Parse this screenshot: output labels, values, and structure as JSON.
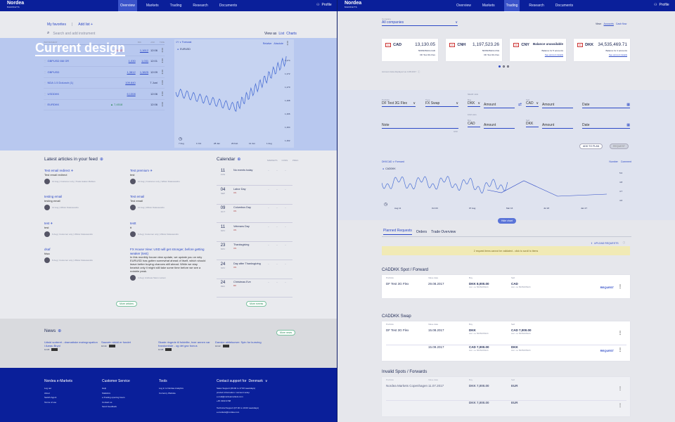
{
  "overlay_label": "Current design",
  "left": {
    "brand": {
      "name": "Nordea",
      "sub": "MARKETS"
    },
    "nav": [
      "Overview",
      "Markets",
      "Trading",
      "Research",
      "Documents"
    ],
    "profile": "Profile",
    "watchlist": {
      "tab1": "My favorites",
      "tab2": "Add list +",
      "search_placeholder": "Search and add instrument",
      "view_as": "View as",
      "view_list": "List",
      "view_charts": "Charts",
      "cols": [
        "INSTRUMENT",
        "",
        "BID",
        "ASK",
        "TIME"
      ],
      "rows": [
        {
          "name": "",
          "sub": "",
          "bid": "",
          "ask": "1,1612",
          "time": "12:06",
          "chg": "▼ 1,1612"
        },
        {
          "name": "GBPUSD 6M OR",
          "sub": "",
          "bid": "1,030",
          "ask": "1,031",
          "time": "12:01",
          "chg": ""
        },
        {
          "name": "GBPUSD",
          "sub": "",
          "bid": "1,3812",
          "ask": "1,3825",
          "time": "12:09",
          "chg": ""
        },
        {
          "name": "NDA 1.5 Dolunch (1)",
          "sub": "",
          "bid": "109.840",
          "ask": "",
          "time": "7 Juni",
          "chg": ""
        },
        {
          "name": "USDDKK",
          "sub": "",
          "bid": "6,1308",
          "ask": "",
          "time": "12:06",
          "chg": ""
        },
        {
          "name": "EURDKK",
          "sub": "",
          "bid": "",
          "ask": "",
          "time": "12:06",
          "chg": "▲ 7,4518"
        }
      ]
    },
    "mini_chart": {
      "range": "1Y ∨ Forecast",
      "relative": "Relative",
      "absolute": "Absolute",
      "legend": "EURUSD",
      "x_labels": [
        "7 Aug",
        "1 Oct",
        "28 Jan",
        "29 Feb",
        "12 Jun",
        "1 Aug"
      ],
      "y_labels": [
        "1,174",
        "1,172",
        "1,170",
        "1,168",
        "1,166",
        "1,164",
        "1,162"
      ]
    },
    "articles": {
      "title": "Latest articles in your feed",
      "items": [
        {
          "title": "Test email redirect ✈",
          "body": "Test email redirect",
          "meta": "10 Aug | Customer only | Trade Hakan Mahtan",
          "col": 0
        },
        {
          "title": "Test premium ✈",
          "body": "test",
          "meta": "10 Aug | Customer only | Wiktor Dalessandro",
          "col": 1
        },
        {
          "title": "testing email",
          "body": "testing email",
          "meta": "10 Aug | Wiktor Dalessandro",
          "col": 0
        },
        {
          "title": "Test email",
          "body": "Test email",
          "meta": "10 Aug | Wiktor Dalessandro",
          "col": 1
        },
        {
          "title": "test ✈",
          "body": "test",
          "meta": "9 Aug | Customer only | Wiktor Dalessandro",
          "col": 0
        },
        {
          "title": "testt",
          "body": "tt",
          "meta": "9 Aug | Customer only | Wiktor Dalessandro",
          "col": 1
        },
        {
          "title": "dsaf",
          "body": "fdsa",
          "meta": "8 Aug | Customer only | Wiktor Dalessandro",
          "col": 0
        },
        {
          "title": "FX House View: USD will get stronger, before getting weaker (test)",
          "body": "In this monthly house view update, we update you on why EURUSD has gotten somewhat ahead of itself, which should leave better buying chances still ahead. While we stay bearish only it might still take some time before we see a notable peak.",
          "meta": "4 Aug | Andreas Steno Larsen",
          "col": 1
        }
      ],
      "more": "More articles"
    },
    "calendar": {
      "title": "Calendar",
      "cols": [
        "MARKETS",
        "CONS.",
        "PREV."
      ],
      "items": [
        {
          "day": "11",
          "mon": "AUG",
          "title": "No events today",
          "flag": ""
        },
        {
          "day": "04",
          "mon": "SEP",
          "title": "Labor Day",
          "flag": "US"
        },
        {
          "day": "09",
          "mon": "OCT",
          "title": "Columbus Day",
          "flag": "US"
        },
        {
          "day": "11",
          "mon": "NOV",
          "title": "Veterans Day",
          "flag": "US"
        },
        {
          "day": "23",
          "mon": "NOV",
          "title": "Thanksgiving",
          "flag": "US"
        },
        {
          "day": "24",
          "mon": "NOV",
          "title": "Day after Thanksgiving",
          "flag": "US"
        },
        {
          "day": "24",
          "mon": "DEC",
          "title": "Christmas Eve",
          "flag": "DK"
        }
      ],
      "more": "More events"
    },
    "news": {
      "title": "News",
      "more": "More news",
      "items": [
        {
          "title": "Udsid sorteret - dramatiske mahngrupation i Aarau Bryol",
          "time": "11:23"
        },
        {
          "title": "Sauvein skidd er fundet",
          "time": "10:44"
        },
        {
          "title": "Skade ringede til foldelite, hver annen var frandomhde - og det gav bonus",
          "time": "11:23"
        },
        {
          "title": "Danske aktiekurser: Spin for kursring",
          "time": "10:22"
        }
      ]
    },
    "footer": {
      "col1": {
        "title": "Nordea e-Markets",
        "links": [
          "Log out",
          "About",
          "Switch Agent",
          "Terms of use"
        ]
      },
      "col2": {
        "title": "Customer Service",
        "links": [
          "Help",
          "Statistics",
          "e-Trading opening hours",
          "Contact us",
          "Send Feedback"
        ]
      },
      "col3": {
        "title": "Tools",
        "links": [
          "Log in to Nordea Analytics",
          "Currency Website"
        ]
      },
      "col4": {
        "title": "Contact support for",
        "country": "Denmark",
        "lines": [
          "Sales Support (09:00 to 17:00 weekdays)",
          "product information / account setup",
          "e-mail@nordeamarkets.com",
          "+45 3333 0798",
          "",
          "Technical Support (07:30 to 19:00 weekdays)",
          "e-markets@nordea.com"
        ]
      }
    }
  },
  "right": {
    "brand": {
      "name": "Nordea",
      "sub": "MARKETS"
    },
    "nav": [
      "Overview",
      "Markets",
      "Trading",
      "Research",
      "Documents"
    ],
    "profile": "Profile",
    "company_label": "Company",
    "company_value": "All companies",
    "view": "View:",
    "accounts": "Accounts",
    "cashflow": "Cash flow",
    "balances": [
      {
        "ccy": "CAD",
        "amount": "13,130.05",
        "sub1": "5035435424-CAD",
        "sub2": "DF Test 3G Flex",
        "flag": "CA"
      },
      {
        "ccy": "CNH",
        "amount": "1,197,523.26",
        "sub1": "5035435424-CNH",
        "sub2": "DF Test 3G Flex",
        "flag": "CN"
      },
      {
        "ccy": "CNY",
        "amount": "Balance unavailable",
        "sub1": "Balance for 5 accounts",
        "sub2": "See account details",
        "flag": "CN"
      },
      {
        "ccy": "DKK",
        "amount": "34,535,469.71",
        "sub1": "Balance for 4 accounts",
        "sub2": "See account details",
        "flag": "DK"
      }
    ],
    "balance_note": "Account data displayed as 4.08.2017",
    "form": {
      "portfolio_label": "Portfolio",
      "portfolio": "DF Test 3G Flex",
      "type_label": "Type",
      "type": "FX Swap",
      "near_leg": "NEAR LEG",
      "far_leg": "FAR LEG",
      "buy": "Buy",
      "sell": "Sell",
      "ccy1": "DKK",
      "ccy2": "CAD",
      "ccy1b": "CAD",
      "ccy2b": "DKK",
      "amount": "Amount",
      "date": "Date",
      "note": "Note",
      "note_count": "0/40",
      "add": "ADD TO PLAN",
      "request": "REQUEST"
    },
    "chart": {
      "title": "DKKCAD ∨ Forward",
      "legend": "CADDKK",
      "toggle1": "Number",
      "toggle2": "Comment",
      "x_labels": [
        "Aug 11",
        "Oct 03",
        "07 Aug",
        "Mar 16",
        "Jul 18",
        "Jan 27"
      ],
      "y_labels": [
        "5.0",
        "4.8",
        "4.7",
        "4.6"
      ],
      "label": "Hide chart"
    },
    "tabs": [
      "Planned Requests",
      "Orders",
      "Trade Overview"
    ],
    "upload": "UPLOAD REQUESTS",
    "warning": "2 request items cannot be validated - click to scroll to items",
    "groups": [
      {
        "title": "CADDKK Spot / Forward",
        "cols": [
          "Portfolio",
          "Value date",
          "Buy",
          "Sell"
        ],
        "rows": [
          {
            "portfolio": "DF Test 3G Flex",
            "date": "29.08.2017",
            "buy": "DKK 8,000.00",
            "buy_sub": "Acc. no 5035435424",
            "sell": "CAD",
            "sell_sub": "Acc. no 5035435424",
            "action": "REQUEST"
          }
        ]
      },
      {
        "title": "CADDKK Swap",
        "cols": [
          "Portfolio",
          "Value date",
          "Buy",
          "Sell"
        ],
        "rows": [
          {
            "portfolio": "DF Test 3G Flex",
            "date": "15.08.2017",
            "buy": "DKK",
            "buy_sub": "Acc. no 5035435424",
            "sell": "CAD 7,000.00",
            "sell_sub": "Acc. no 5035435424",
            "action": ""
          },
          {
            "portfolio": "",
            "date": "15.09.2017",
            "buy": "CAD 7,000.00",
            "buy_sub": "Acc. no 5035435424",
            "sell": "DKK",
            "sell_sub": "Acc. no 5035435424",
            "action": "REQUEST"
          }
        ]
      },
      {
        "title": "Invalid Spots / Forwards",
        "cols": [
          "Portfolio",
          "Value date",
          "Buy",
          "Sell"
        ],
        "rows": [
          {
            "portfolio": "Nordea Markets Copenhagen",
            "date": "11.07.2017",
            "buy": "DKK 7,000.00",
            "buy_sub": "",
            "sell": "EUR",
            "sell_sub": "",
            "action": ""
          },
          {
            "portfolio": "",
            "date": "",
            "buy": "DKK 7,000.00",
            "buy_sub": "",
            "sell": "EUR",
            "sell_sub": "",
            "action": ""
          }
        ]
      }
    ]
  },
  "chart_data": [
    {
      "type": "line",
      "title": "",
      "legend": "EURUSD",
      "x": [
        "7 Aug",
        "1 Oct",
        "28 Jan",
        "29 Feb",
        "12 Jun",
        "1 Aug"
      ],
      "ylim": [
        1.162,
        1.176
      ]
    },
    {
      "type": "line",
      "title": "",
      "legend": "CADDKK",
      "x": [
        "Aug 11",
        "Oct 03",
        "07 Aug",
        "Mar 16",
        "Jul 18",
        "Jan 27"
      ],
      "ylim": [
        4.6,
        5.0
      ]
    }
  ]
}
